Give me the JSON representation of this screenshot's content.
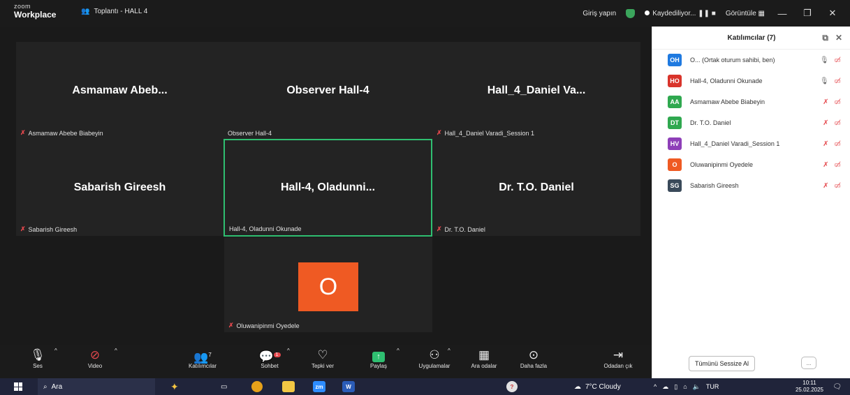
{
  "window": {
    "brand_small": "zoom",
    "brand": "Workplace",
    "meeting_title": "Toplantı - HALL 4",
    "sign_in": "Giriş yapın",
    "recording": "Kaydediliyor...",
    "view": "Görüntüle"
  },
  "tiles": [
    {
      "name": "Asmamaw Abeb...",
      "label": "Asmamaw Abebe Biabeyin",
      "muted": true
    },
    {
      "name": "Observer Hall-4",
      "label": "Observer Hall-4",
      "muted": false
    },
    {
      "name": "Hall_4_Daniel Va...",
      "label": "Hall_4_Daniel Varadi_Session 1",
      "muted": true
    },
    {
      "name": "Sabarish Gireesh",
      "label": "Sabarish Gireesh",
      "muted": true
    },
    {
      "name": "Hall-4,  Oladunni...",
      "label": "Hall-4, Oladunni Okunade",
      "muted": false
    },
    {
      "name": "Dr. T.O. Daniel",
      "label": "Dr. T.O. Daniel",
      "muted": true
    },
    {
      "name": "O",
      "label": "Oluwanipinmi Oyedele",
      "muted": true
    }
  ],
  "panel": {
    "title": "Katılımcılar (7)",
    "participants": [
      {
        "initials": "OH",
        "color": "#1f7ae0",
        "name": "O... (Ortak oturum sahibi, ben)"
      },
      {
        "initials": "HO",
        "color": "#d9342b",
        "name": "Hall-4, Oladunni Okunade"
      },
      {
        "initials": "AA",
        "color": "#2fa84f",
        "name": "Asmamaw Abebe Biabeyin"
      },
      {
        "initials": "DT",
        "color": "#2fa84f",
        "name": "Dr. T.O. Daniel"
      },
      {
        "initials": "HV",
        "color": "#8e3fb8",
        "name": "Hall_4_Daniel Varadi_Session 1"
      },
      {
        "initials": "O",
        "color": "#ef5a23",
        "name": "Oluwanipinmi Oyedele"
      },
      {
        "initials": "SG",
        "color": "#3a4a5a",
        "name": "Sabarish Gireesh"
      }
    ],
    "mute_all": "Tümünü Sessize Al",
    "more": "..."
  },
  "toolbar": {
    "audio": "Ses",
    "video": "Video",
    "participants": "Katılımcılar",
    "participants_count": "7",
    "chat": "Sohbet",
    "chat_badge": "1",
    "react": "Tepki ver",
    "share": "Paylaş",
    "apps": "Uygulamalar",
    "breakout": "Ara odalar",
    "more": "Daha fazla",
    "leave": "Odadan çık"
  },
  "taskbar": {
    "search": "Ara",
    "weather": "7°C  Cloudy",
    "lang": "TUR",
    "time": "10:11",
    "date": "25.02.2025"
  }
}
